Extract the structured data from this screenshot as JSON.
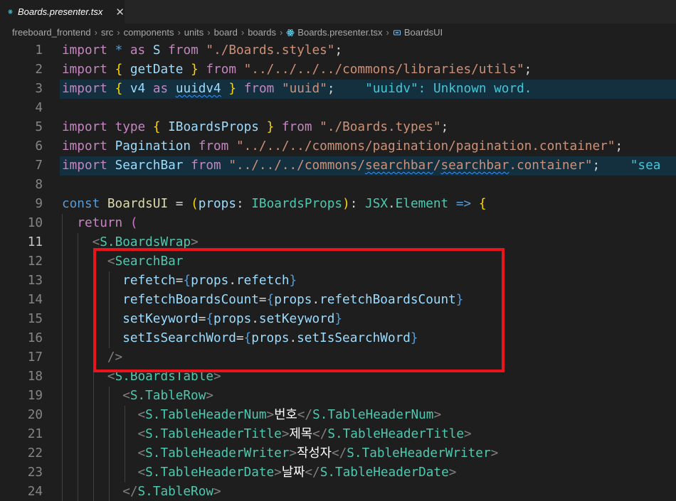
{
  "tab": {
    "filename": "Boards.presenter.tsx",
    "close": "✕"
  },
  "breadcrumb": [
    "freeboard_frontend",
    "src",
    "components",
    "units",
    "board",
    "boards",
    "Boards.presenter.tsx",
    "BoardsUI"
  ],
  "colors": {
    "highlight_box": "#e8151d",
    "background": "#1e1e1e"
  },
  "lines": [
    {
      "n": "1",
      "tokens": [
        [
          "import",
          "k"
        ],
        [
          " ",
          "d"
        ],
        [
          "*",
          "b"
        ],
        [
          " ",
          "d"
        ],
        [
          "as",
          "k"
        ],
        [
          " ",
          "d"
        ],
        [
          "S",
          "v"
        ],
        [
          " ",
          "d"
        ],
        [
          "from",
          "k"
        ],
        [
          " ",
          "d"
        ],
        [
          "\"./Boards.styles\"",
          "s"
        ],
        [
          ";",
          "d"
        ]
      ]
    },
    {
      "n": "2",
      "tokens": [
        [
          "import",
          "k"
        ],
        [
          " ",
          "d"
        ],
        [
          "{",
          "y"
        ],
        [
          " ",
          "d"
        ],
        [
          "getDate",
          "v"
        ],
        [
          " ",
          "d"
        ],
        [
          "}",
          "y"
        ],
        [
          " ",
          "d"
        ],
        [
          "from",
          "k"
        ],
        [
          " ",
          "d"
        ],
        [
          "\"../../../../commons/libraries/utils\"",
          "s"
        ],
        [
          ";",
          "d"
        ]
      ]
    },
    {
      "n": "3",
      "hl": true,
      "tokens": [
        [
          "import",
          "k"
        ],
        [
          " ",
          "d"
        ],
        [
          "{",
          "y"
        ],
        [
          " ",
          "d"
        ],
        [
          "v4",
          "v"
        ],
        [
          " ",
          "d"
        ],
        [
          "as",
          "k"
        ],
        [
          " ",
          "d"
        ],
        [
          "uuidv4",
          "v sq"
        ],
        [
          " ",
          "d"
        ],
        [
          "}",
          "y"
        ],
        [
          " ",
          "d"
        ],
        [
          "from",
          "k"
        ],
        [
          " ",
          "d"
        ],
        [
          "\"uuid\"",
          "s"
        ],
        [
          ";",
          "d"
        ],
        [
          "    ",
          "d"
        ],
        [
          "\"uuidv\": Unknown word.",
          "hint"
        ]
      ]
    },
    {
      "n": "4",
      "tokens": []
    },
    {
      "n": "5",
      "tokens": [
        [
          "import",
          "k"
        ],
        [
          " ",
          "d"
        ],
        [
          "type",
          "k"
        ],
        [
          " ",
          "d"
        ],
        [
          "{",
          "y"
        ],
        [
          " ",
          "d"
        ],
        [
          "IBoardsProps",
          "v"
        ],
        [
          " ",
          "d"
        ],
        [
          "}",
          "y"
        ],
        [
          " ",
          "d"
        ],
        [
          "from",
          "k"
        ],
        [
          " ",
          "d"
        ],
        [
          "\"./Boards.types\"",
          "s"
        ],
        [
          ";",
          "d"
        ]
      ]
    },
    {
      "n": "6",
      "tokens": [
        [
          "import",
          "k"
        ],
        [
          " ",
          "d"
        ],
        [
          "Pagination",
          "v"
        ],
        [
          " ",
          "d"
        ],
        [
          "from",
          "k"
        ],
        [
          " ",
          "d"
        ],
        [
          "\"../../../commons/pagination/pagination.container\"",
          "s"
        ],
        [
          ";",
          "d"
        ]
      ]
    },
    {
      "n": "7",
      "hl": true,
      "tokens": [
        [
          "import",
          "k"
        ],
        [
          " ",
          "d"
        ],
        [
          "SearchBar",
          "v"
        ],
        [
          " ",
          "d"
        ],
        [
          "from",
          "k"
        ],
        [
          " ",
          "d"
        ],
        [
          "\"../../../commons/",
          "s"
        ],
        [
          "searchbar",
          "s sq"
        ],
        [
          "/",
          "s"
        ],
        [
          "searchbar",
          "s sq"
        ],
        [
          ".container\"",
          "s"
        ],
        [
          ";",
          "d"
        ],
        [
          "    ",
          "d"
        ],
        [
          "\"sea",
          "hint"
        ]
      ]
    },
    {
      "n": "8",
      "tokens": []
    },
    {
      "n": "9",
      "tokens": [
        [
          "const",
          "b"
        ],
        [
          " ",
          "d"
        ],
        [
          "BoardsUI",
          "f"
        ],
        [
          " = ",
          "d"
        ],
        [
          "(",
          "y"
        ],
        [
          "props",
          "v"
        ],
        [
          ": ",
          "d"
        ],
        [
          "IBoardsProps",
          "t"
        ],
        [
          ")",
          "y"
        ],
        [
          ": ",
          "d"
        ],
        [
          "JSX",
          "t"
        ],
        [
          ".",
          "d"
        ],
        [
          "Element",
          "t"
        ],
        [
          " ",
          "d"
        ],
        [
          "=>",
          "b"
        ],
        [
          " ",
          "d"
        ],
        [
          "{",
          "y"
        ]
      ]
    },
    {
      "n": "10",
      "tokens": [
        [
          "  ",
          "d"
        ],
        [
          "return",
          "k"
        ],
        [
          " ",
          "d"
        ],
        [
          "(",
          "p"
        ]
      ]
    },
    {
      "n": "11",
      "active": true,
      "tokens": [
        [
          "    ",
          "d"
        ],
        [
          "<",
          "g"
        ],
        [
          "S.BoardsWrap",
          "t"
        ],
        [
          ">",
          "g"
        ]
      ]
    },
    {
      "n": "12",
      "tokens": [
        [
          "      ",
          "d"
        ],
        [
          "<",
          "g"
        ],
        [
          "SearchBar",
          "t"
        ]
      ]
    },
    {
      "n": "13",
      "tokens": [
        [
          "        ",
          "d"
        ],
        [
          "refetch",
          "v"
        ],
        [
          "=",
          "d"
        ],
        [
          "{",
          "b"
        ],
        [
          "props",
          "v"
        ],
        [
          ".",
          "d"
        ],
        [
          "refetch",
          "v"
        ],
        [
          "}",
          "b"
        ]
      ]
    },
    {
      "n": "14",
      "tokens": [
        [
          "        ",
          "d"
        ],
        [
          "refetchBoardsCount",
          "v"
        ],
        [
          "=",
          "d"
        ],
        [
          "{",
          "b"
        ],
        [
          "props",
          "v"
        ],
        [
          ".",
          "d"
        ],
        [
          "refetchBoardsCount",
          "v"
        ],
        [
          "}",
          "b"
        ]
      ]
    },
    {
      "n": "15",
      "tokens": [
        [
          "        ",
          "d"
        ],
        [
          "setKeyword",
          "v"
        ],
        [
          "=",
          "d"
        ],
        [
          "{",
          "b"
        ],
        [
          "props",
          "v"
        ],
        [
          ".",
          "d"
        ],
        [
          "setKeyword",
          "v"
        ],
        [
          "}",
          "b"
        ]
      ]
    },
    {
      "n": "16",
      "tokens": [
        [
          "        ",
          "d"
        ],
        [
          "setIsSearchWord",
          "v"
        ],
        [
          "=",
          "d"
        ],
        [
          "{",
          "b"
        ],
        [
          "props",
          "v"
        ],
        [
          ".",
          "d"
        ],
        [
          "setIsSearchWord",
          "v"
        ],
        [
          "}",
          "b"
        ]
      ]
    },
    {
      "n": "17",
      "tokens": [
        [
          "      ",
          "d"
        ],
        [
          "/>",
          "g"
        ]
      ]
    },
    {
      "n": "18",
      "tokens": [
        [
          "      ",
          "d"
        ],
        [
          "<",
          "g"
        ],
        [
          "S.BoardsTable",
          "t"
        ],
        [
          ">",
          "g"
        ]
      ]
    },
    {
      "n": "19",
      "tokens": [
        [
          "        ",
          "d"
        ],
        [
          "<",
          "g"
        ],
        [
          "S.TableRow",
          "t"
        ],
        [
          ">",
          "g"
        ]
      ]
    },
    {
      "n": "20",
      "tokens": [
        [
          "          ",
          "d"
        ],
        [
          "<",
          "g"
        ],
        [
          "S.TableHeaderNum",
          "t"
        ],
        [
          ">",
          "g"
        ],
        [
          "번호",
          "w"
        ],
        [
          "</",
          "g"
        ],
        [
          "S.TableHeaderNum",
          "t"
        ],
        [
          ">",
          "g"
        ]
      ]
    },
    {
      "n": "21",
      "tokens": [
        [
          "          ",
          "d"
        ],
        [
          "<",
          "g"
        ],
        [
          "S.TableHeaderTitle",
          "t"
        ],
        [
          ">",
          "g"
        ],
        [
          "제목",
          "w"
        ],
        [
          "</",
          "g"
        ],
        [
          "S.TableHeaderTitle",
          "t"
        ],
        [
          ">",
          "g"
        ]
      ]
    },
    {
      "n": "22",
      "tokens": [
        [
          "          ",
          "d"
        ],
        [
          "<",
          "g"
        ],
        [
          "S.TableHeaderWriter",
          "t"
        ],
        [
          ">",
          "g"
        ],
        [
          "작성자",
          "w"
        ],
        [
          "</",
          "g"
        ],
        [
          "S.TableHeaderWriter",
          "t"
        ],
        [
          ">",
          "g"
        ]
      ]
    },
    {
      "n": "23",
      "tokens": [
        [
          "          ",
          "d"
        ],
        [
          "<",
          "g"
        ],
        [
          "S.TableHeaderDate",
          "t"
        ],
        [
          ">",
          "g"
        ],
        [
          "날짜",
          "w"
        ],
        [
          "</",
          "g"
        ],
        [
          "S.TableHeaderDate",
          "t"
        ],
        [
          ">",
          "g"
        ]
      ]
    },
    {
      "n": "24",
      "tokens": [
        [
          "        ",
          "d"
        ],
        [
          "</",
          "g"
        ],
        [
          "S.TableRow",
          "t"
        ],
        [
          ">",
          "g"
        ]
      ]
    }
  ]
}
